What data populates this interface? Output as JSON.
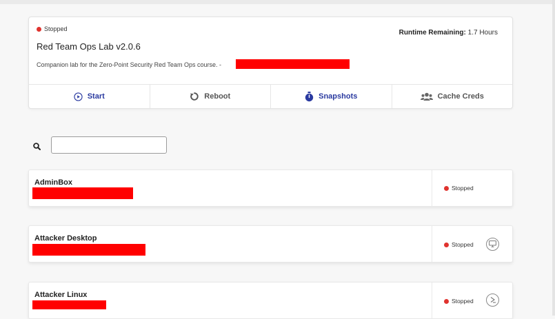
{
  "lab": {
    "status": "Stopped",
    "runtime_label": "Runtime Remaining:",
    "runtime_value": "1.7 Hours",
    "title": "Red Team Ops Lab v2.0.6",
    "description": "Companion lab for the Zero-Point Security Red Team Ops course. -"
  },
  "actions": {
    "start": "Start",
    "reboot": "Reboot",
    "snapshots": "Snapshots",
    "cache_creds": "Cache Creds"
  },
  "search": {
    "value": "",
    "placeholder": ""
  },
  "vms": [
    {
      "name": "AdminBox",
      "status": "Stopped",
      "icon": ""
    },
    {
      "name": "Attacker Desktop",
      "status": "Stopped",
      "icon": "desktop-icon"
    },
    {
      "name": "Attacker Linux",
      "status": "Stopped",
      "icon": "terminal-icon"
    }
  ],
  "colors": {
    "accent": "#2a3aa0",
    "status_stopped": "#e0332e",
    "redaction": "#ff0000"
  }
}
